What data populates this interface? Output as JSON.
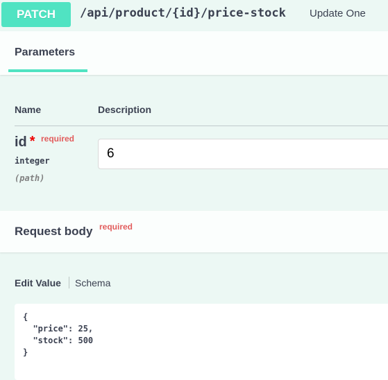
{
  "operation": {
    "method": "PATCH",
    "path": "/api/product/{id}/price-stock",
    "summary": "Update One"
  },
  "parameters": {
    "tab_label": "Parameters",
    "col_name": "Name",
    "col_description": "Description",
    "items": [
      {
        "name": "id",
        "required_star": "*",
        "required_label": "required",
        "type": "integer",
        "in": "(path)",
        "value": "6"
      }
    ]
  },
  "request_body": {
    "title": "Request body",
    "required_label": "required",
    "tabs": [
      "Edit Value",
      "Schema"
    ],
    "code_lines": [
      "{",
      "  \"price\": 25,",
      "  \"stock\": 500",
      "}"
    ]
  },
  "colors": {
    "accent": "#50e3c2",
    "background": "#ecf8f4",
    "required": "#e25c5c"
  }
}
